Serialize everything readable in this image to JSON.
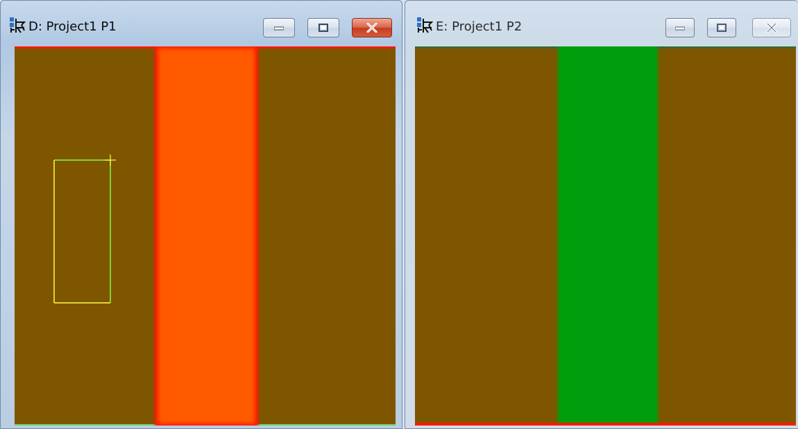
{
  "windows": [
    {
      "id": "D",
      "title": "D: Project1 P1",
      "active": true,
      "controls": [
        "minimize-icon",
        "maximize-icon",
        "close-icon"
      ],
      "image": {
        "background_color": "#7e5600",
        "stripe_color": "#ff5a00",
        "stripe_edge_color": "#ff1a00",
        "selection_box_colors": [
          "#ffff40",
          "#7fff40"
        ]
      }
    },
    {
      "id": "E",
      "title": "E: Project1 P2",
      "active": false,
      "controls": [
        "minimize-icon",
        "maximize-icon",
        "close-icon"
      ],
      "image": {
        "background_color": "#7e5600",
        "stripe_color": "#009e0c",
        "bottom_edge_color": "#ff1a00"
      }
    }
  ]
}
